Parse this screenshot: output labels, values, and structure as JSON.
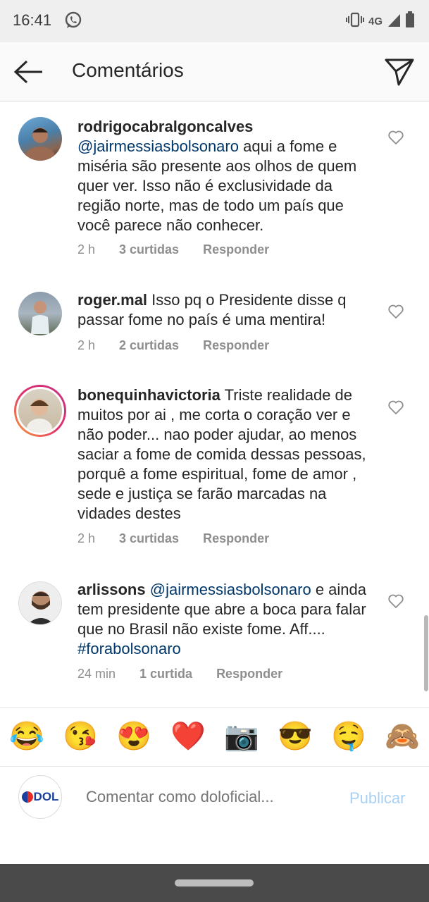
{
  "status_bar": {
    "time": "16:41",
    "network": "4G",
    "icons": [
      "whatsapp-icon",
      "vibrate-icon",
      "signal-icon",
      "battery-icon"
    ]
  },
  "header": {
    "title": "Comentários",
    "icons": [
      "back-arrow-icon",
      "direct-send-icon"
    ]
  },
  "comments": [
    {
      "username": "rodrigocabralgoncalves",
      "mention": "@jairmessiasbolsonaro",
      "text": " aqui a fome e miséria são presente aos olhos de quem quer ver. Isso não é exclusividade da região norte, mas de todo um país que você parece não conhecer.",
      "time": "2 h",
      "likes": "3 curtidas",
      "reply": "Responder"
    },
    {
      "username": "roger.mal",
      "text": " Isso pq o Presidente disse q passar fome no país é uma mentira!",
      "time": "2 h",
      "likes": "2 curtidas",
      "reply": "Responder"
    },
    {
      "username": "bonequinhavictoria",
      "text": " Triste realidade de muitos por ai , me corta o coração ver e não poder... nao poder ajudar, ao menos saciar a fome de comida dessas pessoas, porquê a fome espiritual, fome de amor , sede e justiça  se farão marcadas na vidades destes",
      "time": "2 h",
      "likes": "3 curtidas",
      "reply": "Responder"
    },
    {
      "username": "arlissons",
      "mention": "@jairmessiasbolsonaro",
      "text": " e ainda tem presidente que abre a boca para falar que no Brasil não existe fome. Aff.... ",
      "hashtag": "#forabolsonaro",
      "time": "24 min",
      "likes": "1 curtida",
      "reply": "Responder"
    }
  ],
  "emoji_bar": [
    "😂",
    "😘",
    "😍",
    "❤️",
    "📷",
    "😎",
    "🤤",
    "🙈"
  ],
  "composer": {
    "avatar_text": "DOL",
    "placeholder": "Comentar como doloficial...",
    "publish": "Publicar"
  },
  "colors": {
    "mention": "#00376b",
    "meta": "#8e8e8e",
    "publish_disabled": "#a9d0f5",
    "nav_bar": "#4a4a4a"
  }
}
